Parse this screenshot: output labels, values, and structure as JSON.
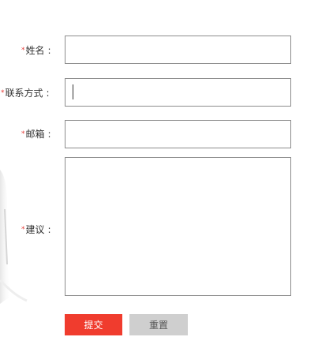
{
  "form": {
    "required_marker": "*",
    "colon": ":",
    "name": {
      "label": "姓名",
      "value": ""
    },
    "contact": {
      "label": "联系方式",
      "value": ""
    },
    "email": {
      "label": "邮箱",
      "value": ""
    },
    "suggestion": {
      "label": "建议",
      "value": ""
    }
  },
  "buttons": {
    "submit_label": "提交",
    "reset_label": "重置"
  },
  "colors": {
    "required": "#e53935",
    "submit": "#f03c2e",
    "reset": "#cfcfcf",
    "border": "#8c8c8c"
  }
}
